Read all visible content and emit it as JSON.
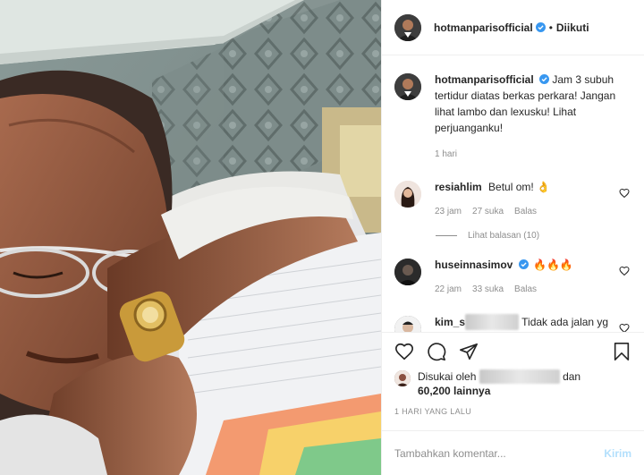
{
  "post": {
    "username": "hotmanparisofficial",
    "dot": "•",
    "follow_status": "Diikuti"
  },
  "caption": {
    "username": "hotmanparisofficial",
    "text": "Jam 3 subuh tertidur diatas berkas perkara! Jangan lihat lambo dan lexusku! Lihat perjuanganku!",
    "time": "1 hari"
  },
  "comments": [
    {
      "username": "resiahlim",
      "text": "Betul om! 👌",
      "time": "23 jam",
      "likes": "27 suka",
      "reply": "Balas",
      "view_replies": "Lihat balasan (10)"
    },
    {
      "username": "huseinnasimov",
      "text": "🔥🔥🔥",
      "time": "22 jam",
      "likes": "33 suka",
      "reply": "Balas"
    },
    {
      "username": "kim_s",
      "text": "Tidak ada jalan yg lunak menuju keberhasilan tidak mungkin tiba"
    }
  ],
  "likes": {
    "prefix": "Disukai oleh",
    "suffix": "dan",
    "count": "60,200 lainnya"
  },
  "date": "1 HARI YANG LALU",
  "add_comment": {
    "placeholder": "Tambahkan komentar...",
    "submit": "Kirim"
  },
  "icons": {
    "verified": "verified-badge-icon",
    "heart": "heart-icon",
    "comment": "comment-icon",
    "share": "share-icon",
    "save": "bookmark-icon"
  },
  "colors": {
    "verified": "#3897f0",
    "muted": "#8e8e8e",
    "submit_disabled": "#b2dffc"
  }
}
